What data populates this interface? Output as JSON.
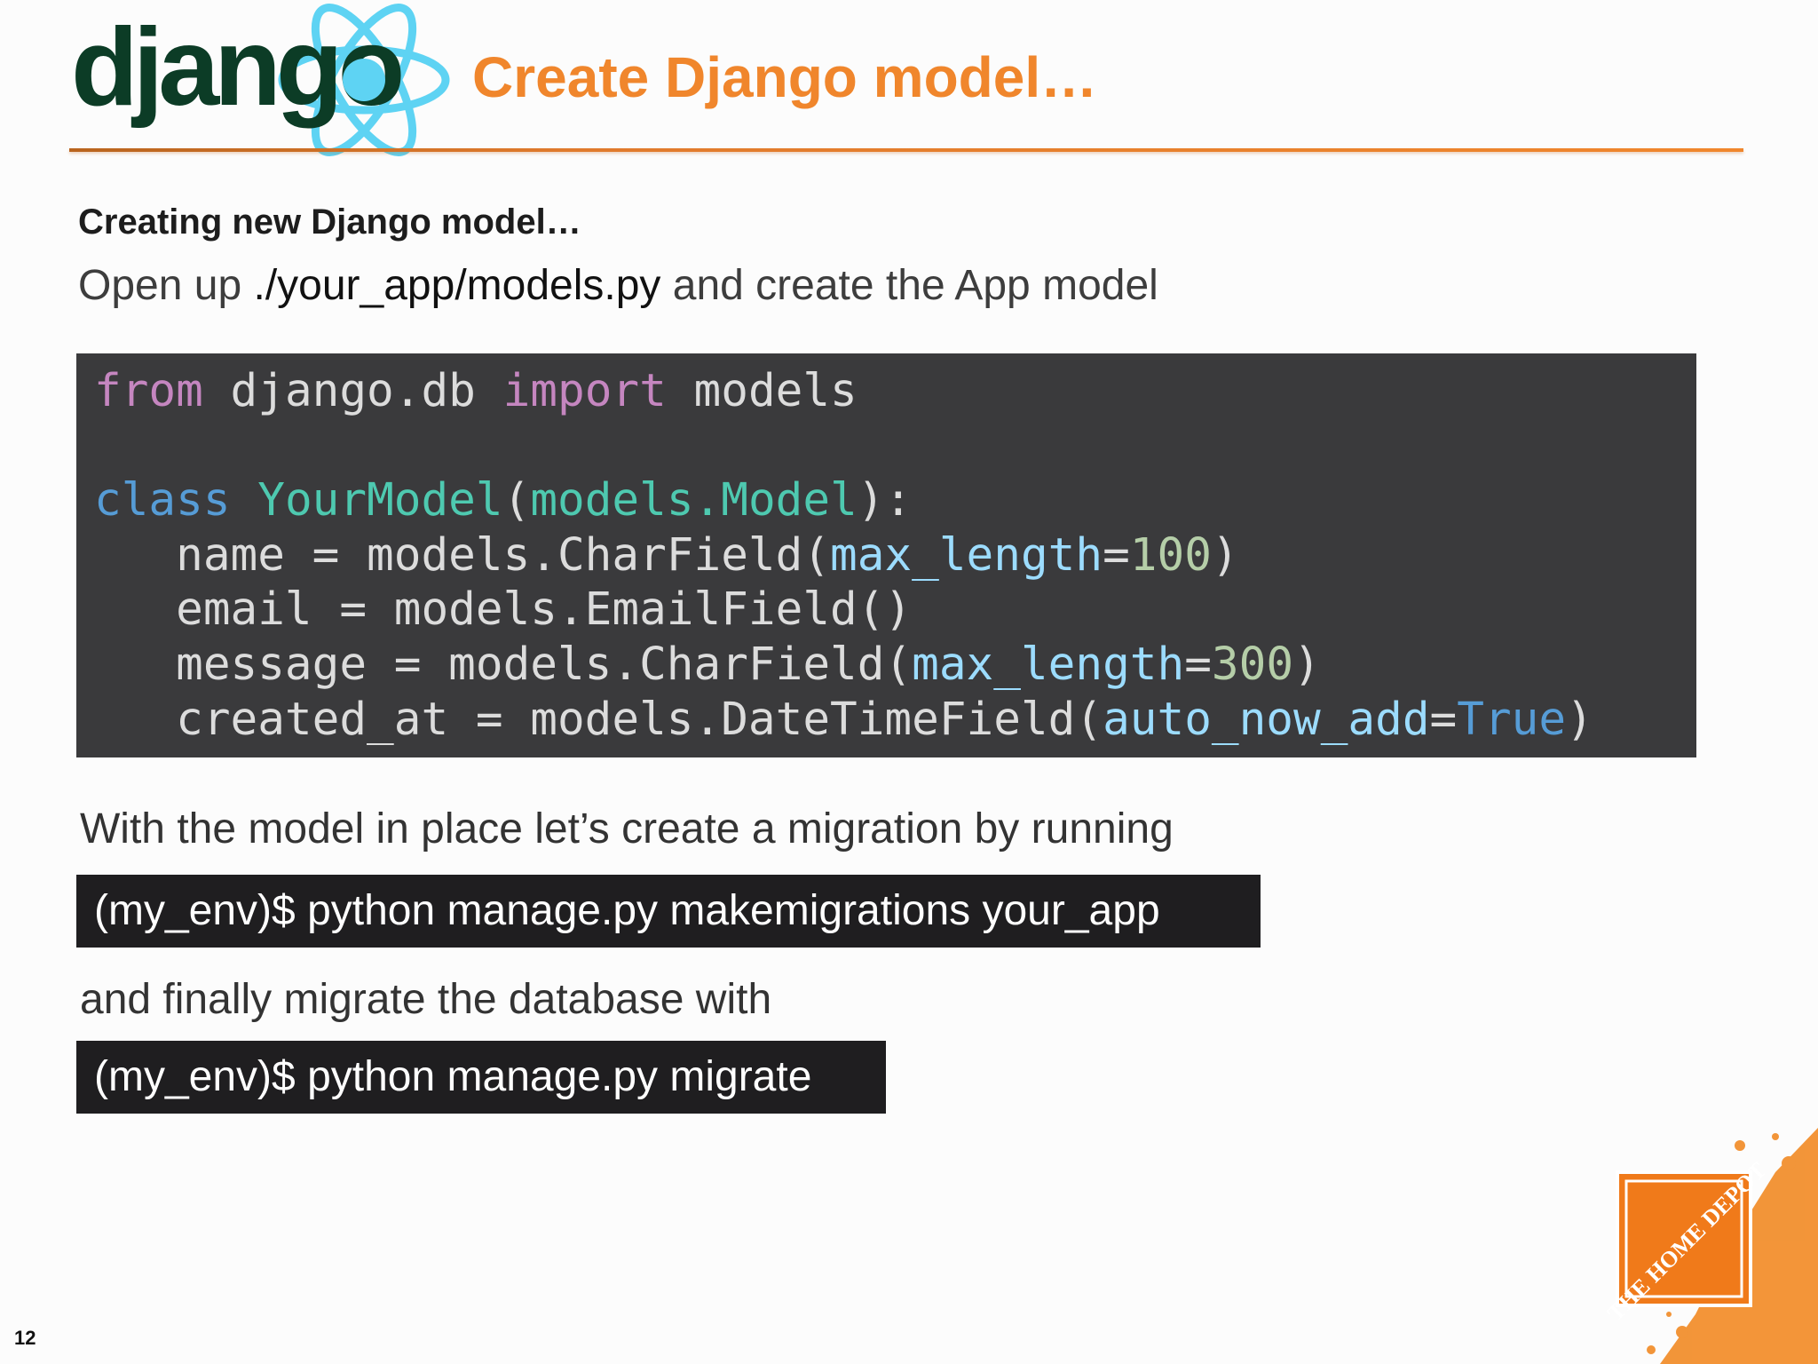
{
  "header": {
    "logo_text": "django",
    "title": "Create Django model…"
  },
  "content": {
    "subheading": "Creating new Django model…",
    "intro_prefix": "Open up ",
    "intro_path": "./your_app/models.py",
    "intro_suffix": " and create the App model",
    "code": {
      "l1": {
        "t1": "from",
        "t2": " django.db ",
        "t3": "import",
        "t4": " models"
      },
      "l3": {
        "t1": "class",
        "t2": " ",
        "t3": "YourModel",
        "t4": "(",
        "t5": "models.Model",
        "t6": "):"
      },
      "l4": {
        "t1": "   name = models.CharField(",
        "t2": "max_length",
        "t3": "=",
        "t4": "100",
        "t5": ")"
      },
      "l5": {
        "t1": "   email = models.EmailField()"
      },
      "l6": {
        "t1": "   message = models.CharField(",
        "t2": "max_length",
        "t3": "=",
        "t4": "300",
        "t5": ")"
      },
      "l7": {
        "t1": "   created_at = models.DateTimeField(",
        "t2": "auto_now_add",
        "t3": "=",
        "t4": "True",
        "t5": ")"
      }
    },
    "migration_text": "With the model in place let’s create a migration by running",
    "makemigrations_cmd": "(my_env)$ python manage.py makemigrations your_app",
    "migrate_text": "and finally migrate the database with",
    "migrate_cmd": "(my_env)$ python manage.py migrate"
  },
  "footer": {
    "page_number": "12",
    "brand_logo_text": "THE HOME DEPOT"
  },
  "colors": {
    "title": "#f0862c",
    "django_green": "#0c3c26",
    "react_blue": "#5ed3f3",
    "code_bg": "#3a3a3c",
    "cmd_bg": "#1f1e20"
  }
}
